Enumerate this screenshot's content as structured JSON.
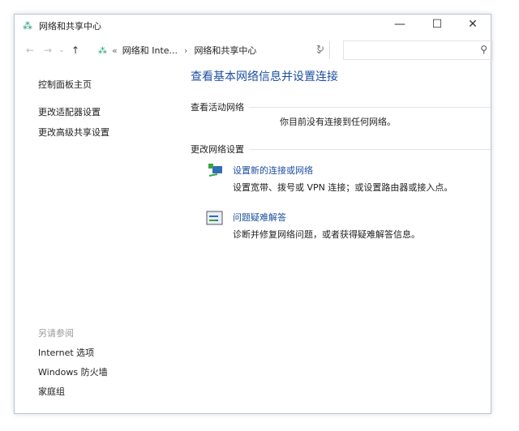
{
  "window": {
    "title": "网络和共享中心",
    "minimize": "—",
    "maximize": "☐",
    "close": "✕"
  },
  "nav": {
    "back": "←",
    "forward": "→",
    "recent": "⌄",
    "up": "↑",
    "breadcrumb_prefix": "«",
    "crumb1": "网络和 Inte...",
    "sep": "›",
    "crumb2": "网络和共享中心",
    "dropdown": "⌄",
    "refresh": "↻",
    "search_placeholder": "",
    "search_icon": "⚲"
  },
  "sidebar": {
    "items": [
      {
        "label": "控制面板主页"
      },
      {
        "label": "更改适配器设置"
      },
      {
        "label": "更改高级共享设置"
      }
    ],
    "see_also": "另请参阅",
    "see_also_items": [
      {
        "label": "Internet 选项"
      },
      {
        "label": "Windows 防火墙"
      },
      {
        "label": "家庭组"
      }
    ]
  },
  "main": {
    "title": "查看基本网络信息并设置连接",
    "active_section": "查看活动网络",
    "no_network": "你目前没有连接到任何网络。",
    "change_section": "更改网络设置",
    "tasks": [
      {
        "label": "设置新的连接或网络",
        "desc": "设置宽带、拨号或 VPN 连接；或设置路由器或接入点。",
        "icon": "new-connection-icon"
      },
      {
        "label": "问题疑难解答",
        "desc": "诊断并修复网络问题，或者获得疑难解答信息。",
        "icon": "troubleshoot-icon"
      }
    ]
  }
}
